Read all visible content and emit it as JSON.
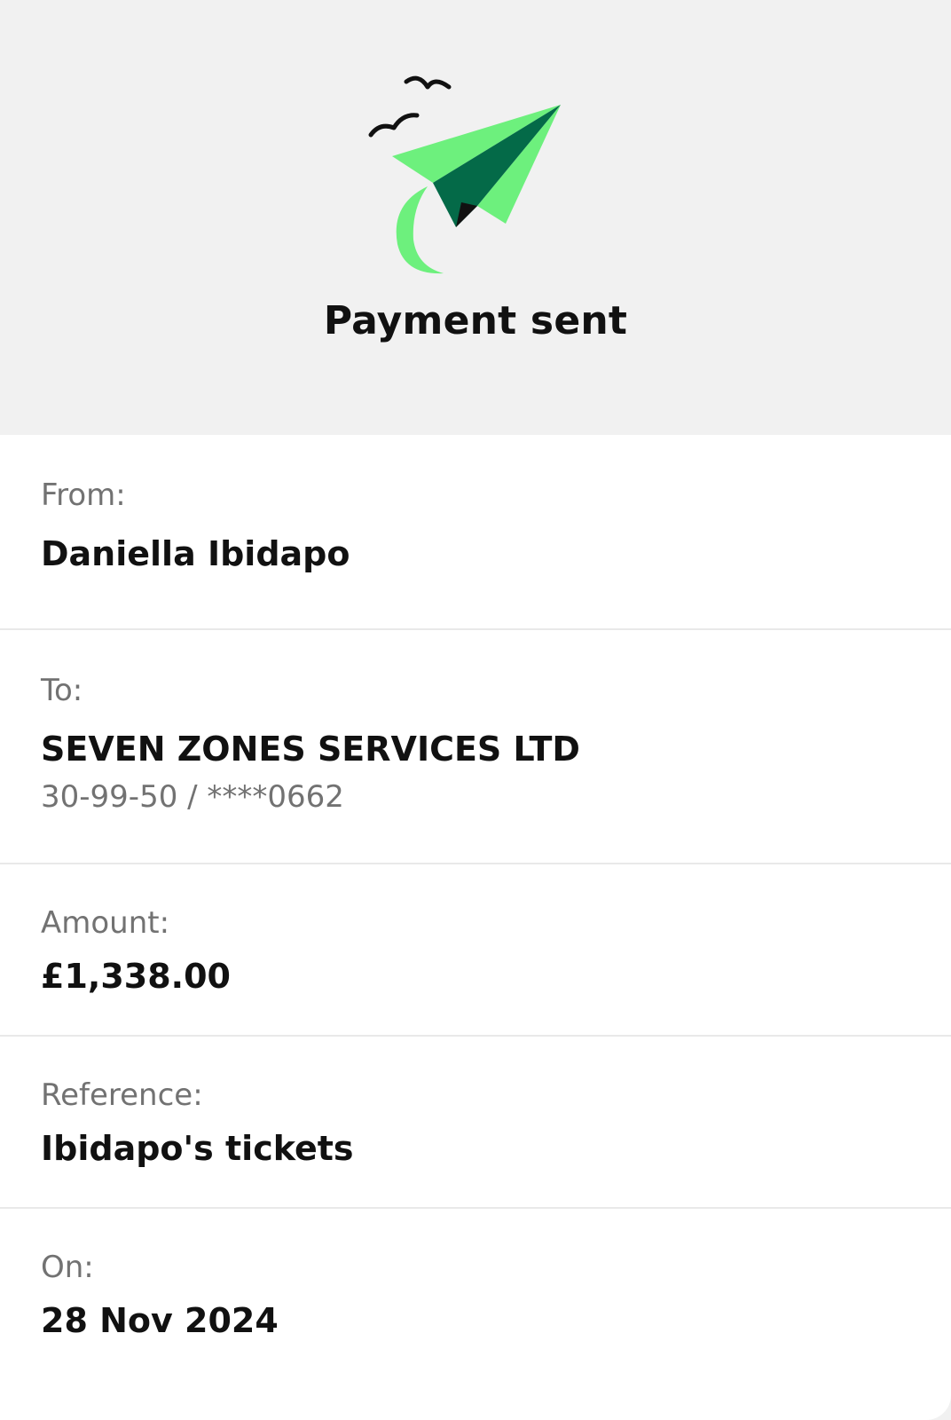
{
  "header": {
    "title": "Payment sent",
    "illustration": "paper-plane-with-birds-icon",
    "colors": {
      "plane_light": "#6df07d",
      "plane_dark": "#046a48",
      "ink": "#111111"
    }
  },
  "details": {
    "from": {
      "label": "From:",
      "value": "Daniella Ibidapo"
    },
    "to": {
      "label": "To:",
      "value": "SEVEN ZONES SERVICES LTD",
      "account": "30-99-50 / ****0662"
    },
    "amount": {
      "label": "Amount:",
      "value": "£1,338.00"
    },
    "reference": {
      "label": "Reference:",
      "value": "Ibidapo's tickets"
    },
    "on": {
      "label": "On:",
      "value": "28 Nov 2024"
    }
  }
}
